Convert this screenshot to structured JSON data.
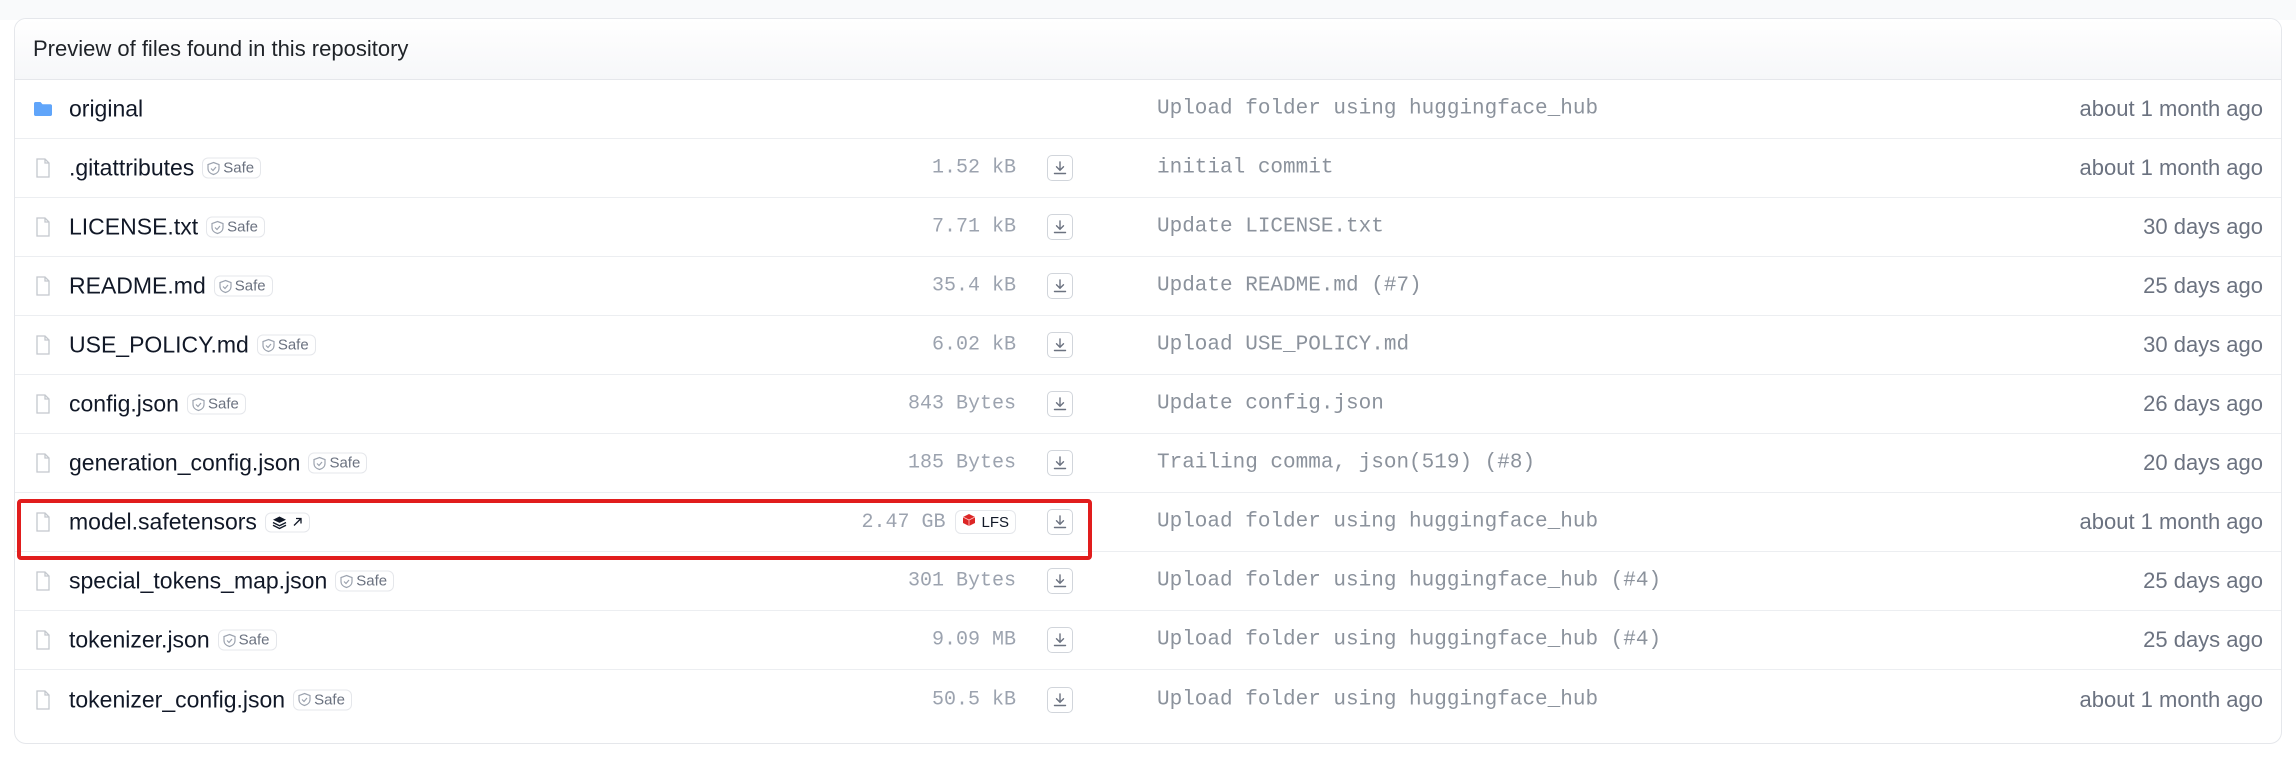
{
  "panel": {
    "title": "Preview of files found in this repository"
  },
  "files": [
    {
      "name": "original",
      "type": "folder",
      "size": "",
      "badge": "",
      "lfs": false,
      "xet": false,
      "commit": "Upload folder using huggingface_hub",
      "date": "about 1 month ago",
      "download": false
    },
    {
      "name": ".gitattributes",
      "type": "file",
      "size": "1.52 kB",
      "badge": "Safe",
      "lfs": false,
      "xet": false,
      "commit": "initial commit",
      "date": "about 1 month ago",
      "download": true
    },
    {
      "name": "LICENSE.txt",
      "type": "file",
      "size": "7.71 kB",
      "badge": "Safe",
      "lfs": false,
      "xet": false,
      "commit": "Update LICENSE.txt",
      "date": "30 days ago",
      "download": true
    },
    {
      "name": "README.md",
      "type": "file",
      "size": "35.4 kB",
      "badge": "Safe",
      "lfs": false,
      "xet": false,
      "commit": "Update README.md (#7)",
      "date": "25 days ago",
      "download": true
    },
    {
      "name": "USE_POLICY.md",
      "type": "file",
      "size": "6.02 kB",
      "badge": "Safe",
      "lfs": false,
      "xet": false,
      "commit": "Upload USE_POLICY.md",
      "date": "30 days ago",
      "download": true
    },
    {
      "name": "config.json",
      "type": "file",
      "size": "843 Bytes",
      "badge": "Safe",
      "lfs": false,
      "xet": false,
      "commit": "Update config.json",
      "date": "26 days ago",
      "download": true
    },
    {
      "name": "generation_config.json",
      "type": "file",
      "size": "185 Bytes",
      "badge": "Safe",
      "lfs": false,
      "xet": false,
      "commit": "Trailing comma, json(519) (#8)",
      "date": "20 days ago",
      "download": true
    },
    {
      "name": "model.safetensors",
      "type": "file",
      "size": "2.47 GB",
      "badge": "",
      "lfs": true,
      "lfs_label": "LFS",
      "xet": true,
      "commit": "Upload folder using huggingface_hub",
      "date": "about 1 month ago",
      "download": true,
      "highlighted": true
    },
    {
      "name": "special_tokens_map.json",
      "type": "file",
      "size": "301 Bytes",
      "badge": "Safe",
      "lfs": false,
      "xet": false,
      "commit": "Upload folder using huggingface_hub (#4)",
      "date": "25 days ago",
      "download": true
    },
    {
      "name": "tokenizer.json",
      "type": "file",
      "size": "9.09 MB",
      "badge": "Safe",
      "lfs": false,
      "xet": false,
      "commit": "Upload folder using huggingface_hub (#4)",
      "date": "25 days ago",
      "download": true
    },
    {
      "name": "tokenizer_config.json",
      "type": "file",
      "size": "50.5 kB",
      "badge": "Safe",
      "lfs": false,
      "xet": false,
      "commit": "Upload folder using huggingface_hub",
      "date": "about 1 month ago",
      "download": true
    }
  ],
  "icons": {
    "folder": "folder-icon",
    "file": "file-icon",
    "safe": "shield-check-icon",
    "download": "download-icon",
    "lfs": "lfs-cube-icon",
    "xet": "layers-icon",
    "external": "external-link-icon"
  },
  "colors": {
    "folder": "#60a5fa",
    "highlight": "#e11d1d",
    "lfs_cube": "#dc2626"
  }
}
